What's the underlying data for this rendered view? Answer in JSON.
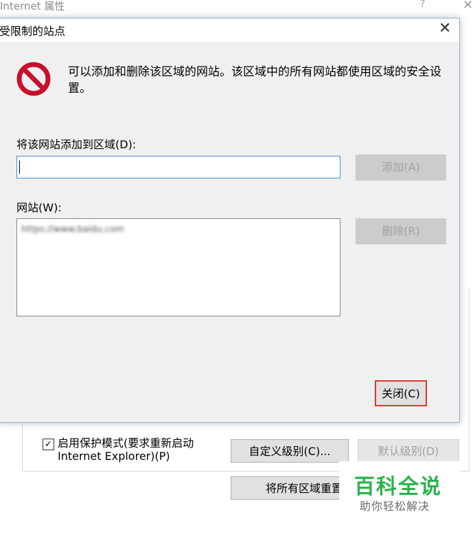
{
  "parent": {
    "title": "Internet 属性",
    "help_label": "?",
    "close_label": "✕",
    "protected_mode_checked": "✓",
    "protected_mode_label": "启用保护模式(要求重新启动 Internet Explorer)(P)",
    "custom_level_button": "自定义级别(C)...",
    "default_level_button": "默认级别(D)",
    "reset_all_button": "将所有区域重置"
  },
  "dialog": {
    "title": "受限制的站点",
    "close_label": "✕",
    "info_text": "可以添加和删除该区域的网站。该区域中的所有网站都使用区域的安全设置。",
    "add_label": "将该网站添加到区域(D):",
    "input_value": "",
    "add_button": "添加(A)",
    "sites_label": "网站(W):",
    "sites": [
      "https://www.baidu.com"
    ],
    "remove_button": "删除(R)",
    "close_button": "关闭(C)"
  },
  "watermark": {
    "title": "百科全说",
    "subtitle": "助你轻松解决"
  },
  "colors": {
    "accent_border": "#e0342e",
    "input_focus": "#4a8ed4",
    "watermark_green": "#2bb24c",
    "stop_icon_red": "#c8102e"
  },
  "icons": [
    "no-entry-icon",
    "close-icon",
    "help-icon",
    "checkbox-check-icon"
  ]
}
